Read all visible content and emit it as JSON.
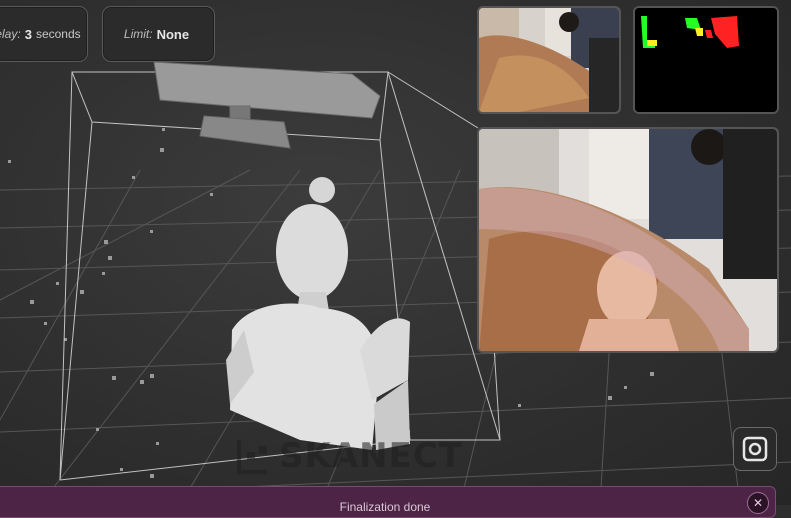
{
  "toolbar": {
    "delay": {
      "key": "elay:",
      "value": "3",
      "unit": "seconds"
    },
    "limit": {
      "key": "Limit:",
      "value": "None"
    }
  },
  "viewport": {
    "brand": "SKANECT",
    "grid_color": "#5a5a5a",
    "box_color": "#d8d8d8",
    "model_color": "#e0e0e0"
  },
  "previews": {
    "rgb_small": {
      "icon": "camera-rgb-feed"
    },
    "mask": {
      "icon": "segmentation-mask",
      "colors": [
        "#22ff22",
        "#ffee22",
        "#ff2222"
      ]
    },
    "rgb_large": {
      "icon": "camera-rgb-feed-large"
    }
  },
  "status": {
    "message": "Finalization done",
    "bar_color": "#4e2446"
  },
  "buttons": {
    "snapshot_icon": "square-snapshot-icon",
    "close_icon": "close-icon"
  }
}
